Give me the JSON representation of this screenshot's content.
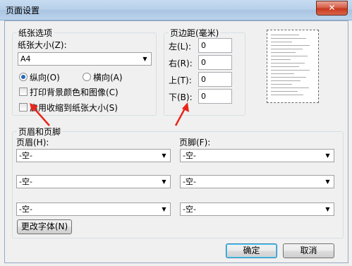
{
  "window": {
    "title": "页面设置",
    "close_symbol": "✕"
  },
  "paper": {
    "legend": "纸张选项",
    "size_label": "纸张大小(Z):",
    "size_value": "A4",
    "orientation": {
      "portrait_label": "纵向(O)",
      "landscape_label": "横向(A)",
      "selected": "portrait"
    },
    "print_bg_label": "打印背景颜色和图像(C)",
    "shrink_label": "启用收缩到纸张大小(S)"
  },
  "margins": {
    "legend": "页边距(毫米)",
    "left_label": "左(L):",
    "left_value": "0",
    "right_label": "右(R):",
    "right_value": "0",
    "top_label": "上(T):",
    "top_value": "0",
    "bottom_label": "下(B):",
    "bottom_value": "0"
  },
  "headers": {
    "legend": "页眉和页脚",
    "header_label": "页眉(H):",
    "footer_label": "页脚(F):",
    "header_values": [
      "-空-",
      "-空-",
      "-空-"
    ],
    "footer_values": [
      "-空-",
      "-空-",
      "-空-"
    ],
    "font_button": "更改字体(N)"
  },
  "buttons": {
    "ok": "确定",
    "cancel": "取消"
  },
  "annotations": {
    "arrow_color": "#e8261c"
  },
  "colors": {
    "title_gradient_top": "#c7dcf1",
    "accent": "#2469ba",
    "close_red": "#c8381d"
  }
}
